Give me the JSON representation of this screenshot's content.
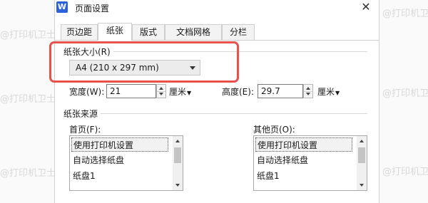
{
  "watermark": {
    "text": "@打印机卫士"
  },
  "window": {
    "logo": "W",
    "title": "页面设置",
    "close_glyph": "✕"
  },
  "tabs": [
    {
      "label": "页边距",
      "active": false
    },
    {
      "label": "纸张",
      "active": true
    },
    {
      "label": "版式",
      "active": false
    },
    {
      "label": "文档网格",
      "active": false
    },
    {
      "label": "分栏",
      "active": false
    }
  ],
  "paper_size": {
    "group_label": "纸张大小(R)",
    "selected": "A4 (210 x 297 mm)"
  },
  "width": {
    "label": "宽度(W):",
    "value": "21",
    "unit": "厘米"
  },
  "height": {
    "label": "高度(E):",
    "value": "29.7",
    "unit": "厘米"
  },
  "paper_source": {
    "group_label": "纸张来源",
    "first_page": {
      "label": "首页(F):",
      "items": [
        "使用打印机设置",
        "自动选择纸盘",
        "纸盘1"
      ],
      "selected_index": 0
    },
    "other_pages": {
      "label": "其他页(O):",
      "items": [
        "使用打印机设置",
        "自动选择纸盘",
        "纸盘1"
      ],
      "selected_index": 0
    }
  },
  "colors": {
    "highlight": "#e8524a",
    "app_logo": "#2b62d9"
  }
}
